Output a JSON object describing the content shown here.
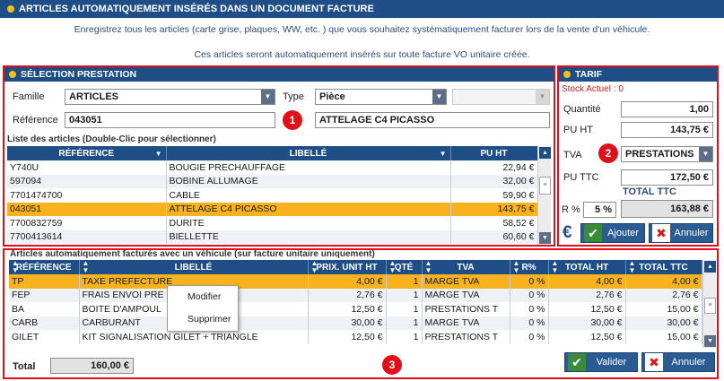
{
  "window": {
    "title": "ARTICLES AUTOMATIQUEMENT INSÉRÉS DANS UN DOCUMENT FACTURE"
  },
  "intro": {
    "line1": "Enregistrez tous les articles (carte grise, plaques, WW, etc. ) que vous souhaitez systématiquement facturer lors de la vente d'un véhicule.",
    "line2": "Ces articles seront automatiquement insérés sur toute facture VO unitaire créée."
  },
  "selection": {
    "title": "SÉLECTION PRESTATION",
    "famille_label": "Famille",
    "famille_value": "ARTICLES",
    "type_label": "Type",
    "type_value": "Pièce",
    "type2_value": "",
    "reference_label": "Référence",
    "reference_value": "043051",
    "libelle_value": "ATTELAGE C4 PICASSO",
    "badge": "1",
    "list_caption": "Liste des articles (Double-Clic pour sélectionner)",
    "columns": [
      "RÉFÉRENCE",
      "LIBELLÉ",
      "PU HT"
    ],
    "rows": [
      {
        "ref": "Y740U",
        "libelle": "BOUGIE PRECHAUFFAGE",
        "pu": "22,94 €"
      },
      {
        "ref": "597094",
        "libelle": "BOBINE ALLUMAGE",
        "pu": "32,00 €"
      },
      {
        "ref": "7701474700",
        "libelle": "CABLE",
        "pu": "59,90 €"
      },
      {
        "ref": "043051",
        "libelle": "ATTELAGE C4 PICASSO",
        "pu": "143,75 €"
      },
      {
        "ref": "7700832759",
        "libelle": "DURITE",
        "pu": "58,52 €"
      },
      {
        "ref": "7700413614",
        "libelle": "BIELLETTE",
        "pu": "60,60 €"
      }
    ],
    "selected_row": 3
  },
  "tarif": {
    "title": "TARIF",
    "stock_label": "Stock Actuel : 0",
    "quantite_label": "Quantité",
    "quantite_value": "1,00",
    "pu_ht_label": "PU HT",
    "pu_ht_value": "143,75 €",
    "tva_label": "TVA",
    "tva_value": "PRESTATIONS",
    "pu_ttc_label": "PU TTC",
    "pu_ttc_value": "172,50 €",
    "total_ttc_label": "TOTAL TTC",
    "remise_label": "R %",
    "remise_value": "5 %",
    "total_ttc_value": "163,88 €",
    "currency_symbol": "€",
    "badge": "2",
    "add_label": "Ajouter",
    "cancel_label": "Annuler"
  },
  "auto": {
    "caption": "Articles automatiquement facturés avec un véhicule (sur facture unitaire uniquement)",
    "columns": [
      "RÉFÉRENCE",
      "LIBELLÉ",
      "PRIX. UNIT HT",
      "QTÉ",
      "TVA",
      "R%",
      "TOTAL HT",
      "TOTAL TTC"
    ],
    "rows": [
      {
        "ref": "TP",
        "libelle": "TAXE PREFECTURE",
        "prix": "4,00 €",
        "qte": "1",
        "tva": "MARGE TVA",
        "r": "0 %",
        "total_ht": "4,00 €",
        "total_ttc": "4,00 €"
      },
      {
        "ref": "FEP",
        "libelle": "FRAIS ENVOI PRE",
        "prix": "2,76 €",
        "qte": "1",
        "tva": "MARGE TVA",
        "r": "0 %",
        "total_ht": "2,76 €",
        "total_ttc": "2,76 €"
      },
      {
        "ref": "BA",
        "libelle": "BOITE D'AMPOUL",
        "prix": "12,50 €",
        "qte": "1",
        "tva": "PRESTATIONS T",
        "r": "0 %",
        "total_ht": "12,50 €",
        "total_ttc": "15,00 €"
      },
      {
        "ref": "CARB",
        "libelle": "CARBURANT",
        "prix": "30,00 €",
        "qte": "1",
        "tva": "MARGE TVA",
        "r": "0 %",
        "total_ht": "30,00 €",
        "total_ttc": "30,00 €"
      },
      {
        "ref": "GILET",
        "libelle": "KIT SIGNALISATION GILET + TRIANGLE",
        "prix": "12,50 €",
        "qte": "1",
        "tva": "PRESTATIONS T",
        "r": "0 %",
        "total_ht": "12,50 €",
        "total_ttc": "15,00 €"
      }
    ],
    "selected_row": 0,
    "context_menu": [
      "Modifier",
      "Supprimer"
    ],
    "total_label": "Total",
    "total_value": "160,00 €",
    "badge": "3",
    "validate_label": "Valider",
    "cancel_label": "Annuler"
  },
  "colors": {
    "header_blue": "#1f4e86",
    "highlight_red": "#e0101a",
    "selected_orange": "#f7b21e",
    "title_dot": "#f2c218"
  }
}
